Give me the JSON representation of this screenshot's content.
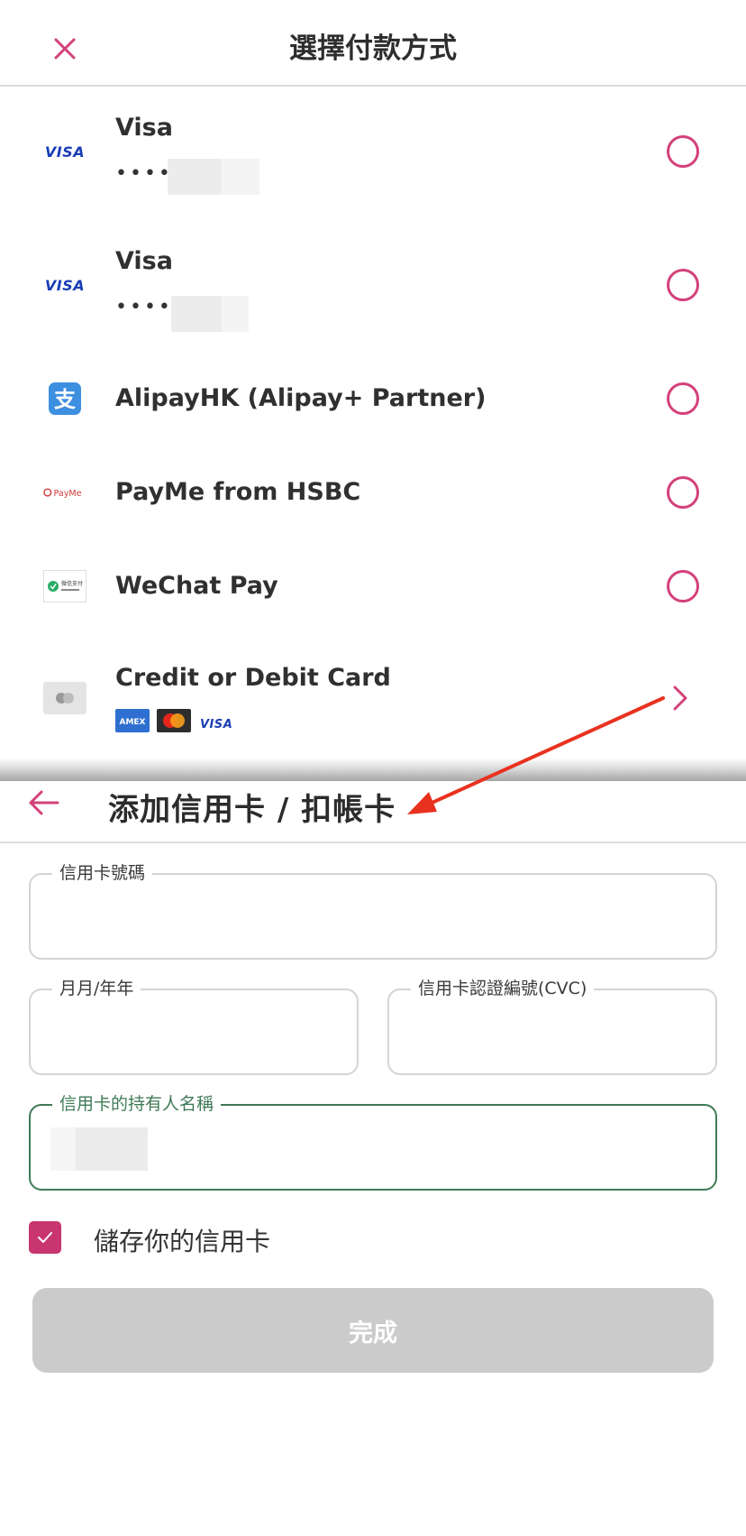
{
  "top_sheet": {
    "title": "選擇付款方式",
    "methods": [
      {
        "name": "Visa",
        "icon": "visa-logo",
        "icon_text": "VISA",
        "masked": "••••",
        "selected": false
      },
      {
        "name": "Visa",
        "icon": "visa-logo",
        "icon_text": "VISA",
        "masked": "••••",
        "selected": false
      },
      {
        "name": "AlipayHK (Alipay+ Partner)",
        "icon": "alipay-logo",
        "icon_text": "支",
        "selected": false
      },
      {
        "name": "PayMe from HSBC",
        "icon": "payme-logo",
        "icon_text": "PayMe",
        "selected": false
      },
      {
        "name": "WeChat Pay",
        "icon": "wechat-pay-logo",
        "icon_text": "微信支付",
        "selected": false
      },
      {
        "name": "Credit or Debit Card",
        "icon": "card-icon",
        "brands": [
          "AMEX",
          "Mastercard",
          "VISA"
        ]
      }
    ]
  },
  "bottom_sheet": {
    "title": "添加信用卡 / 扣帳卡",
    "fields": {
      "card_number_label": "信用卡號碼",
      "expiry_label": "月月/年年",
      "cvc_label": "信用卡認證編號(CVC)",
      "holder_label": "信用卡的持有人名稱"
    },
    "save_card_label": "儲存你的信用卡",
    "save_card_checked": true,
    "done_label": "完成"
  },
  "colors": {
    "accent_pink": "#d3417a",
    "checkbox_pink": "#c8356f",
    "active_green": "#3f7a55",
    "disabled_button": "#cbcbcb",
    "annotation_arrow": "#e8321f",
    "visa_blue": "#1a3db5"
  }
}
